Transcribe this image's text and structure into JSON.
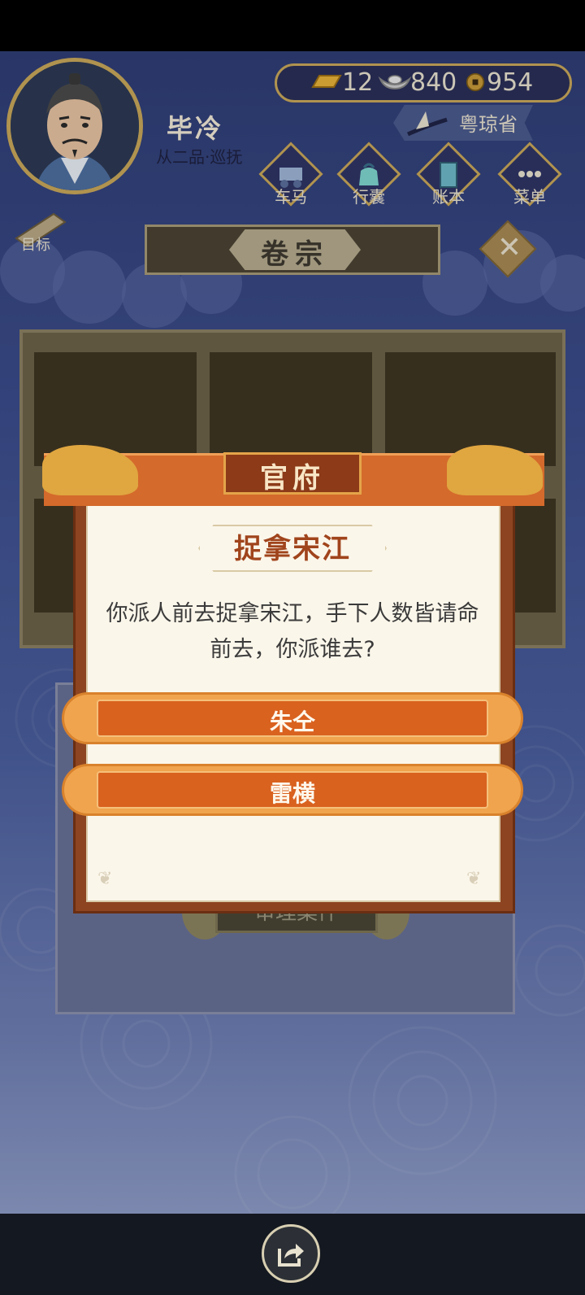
{
  "header": {
    "player_name": "毕冷",
    "rank": "从二品·巡抚",
    "currency": {
      "gold": "12",
      "silver": "840",
      "coins": "954"
    },
    "region": "粤琼省",
    "nav": [
      {
        "label": "车马",
        "icon": "carriage-icon"
      },
      {
        "label": "行囊",
        "icon": "bag-icon"
      },
      {
        "label": "账本",
        "icon": "ledger-icon"
      },
      {
        "label": "菜单",
        "icon": "menu-dots-icon"
      }
    ],
    "goal_label": "目标"
  },
  "panel": {
    "title": "卷宗",
    "review_button": "审理案件"
  },
  "popup": {
    "header": "官府",
    "title": "捉拿宋江",
    "message": "你派人前去捉拿宋江，手下人数皆请命前去，你派谁去?",
    "choices": [
      "朱仝",
      "雷横"
    ]
  },
  "colors": {
    "background": "#3b4c8b",
    "popup_accent": "#d9621f",
    "gold_trim": "#c9a85a"
  }
}
